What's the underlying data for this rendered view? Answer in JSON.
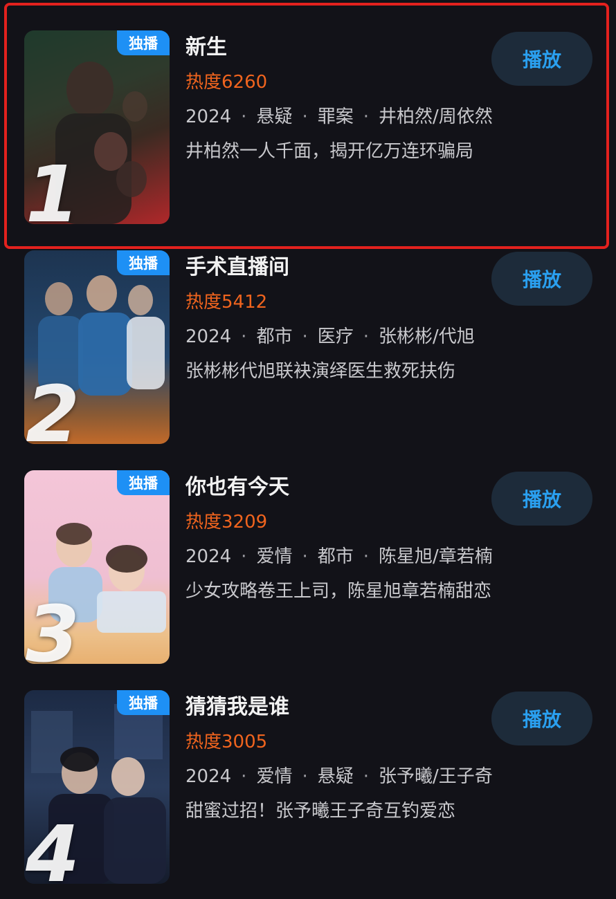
{
  "shows": [
    {
      "rank": "1",
      "badge": "独播",
      "title": "新生",
      "heat_label": "热度",
      "heat_value": "6260",
      "year": "2024",
      "genre1": "悬疑",
      "genre2": "罪案",
      "cast": "井柏然/周依然",
      "description": "井柏然一人千面，揭开亿万连环骗局",
      "play_label": "播放",
      "poster_colors": [
        "#1f3a2c",
        "#3a2a22",
        "#b0282a"
      ]
    },
    {
      "rank": "2",
      "badge": "独播",
      "title": "手术直播间",
      "heat_label": "热度",
      "heat_value": "5412",
      "year": "2024",
      "genre1": "都市",
      "genre2": "医疗",
      "cast": "张彬彬/代旭",
      "description": "张彬彬代旭联袂演绎医生救死扶伤",
      "play_label": "播放",
      "poster_colors": [
        "#1d3450",
        "#24476e",
        "#c26a2a"
      ]
    },
    {
      "rank": "3",
      "badge": "独播",
      "title": "你也有今天",
      "heat_label": "热度",
      "heat_value": "3209",
      "year": "2024",
      "genre1": "爱情",
      "genre2": "都市",
      "cast": "陈星旭/章若楠",
      "description": "少女攻略卷王上司，陈星旭章若楠甜恋",
      "play_label": "播放",
      "poster_colors": [
        "#f4c6d8",
        "#e9b7c9",
        "#e8b070"
      ]
    },
    {
      "rank": "4",
      "badge": "独播",
      "title": "猜猜我是谁",
      "heat_label": "热度",
      "heat_value": "3005",
      "year": "2024",
      "genre1": "爱情",
      "genre2": "悬疑",
      "cast": "张予曦/王子奇",
      "description": "甜蜜过招！张予曦王子奇互钓爱恋",
      "play_label": "播放",
      "poster_colors": [
        "#1c2a44",
        "#2a3c5c",
        "#151c2c"
      ]
    }
  ],
  "highlight_index": 0
}
